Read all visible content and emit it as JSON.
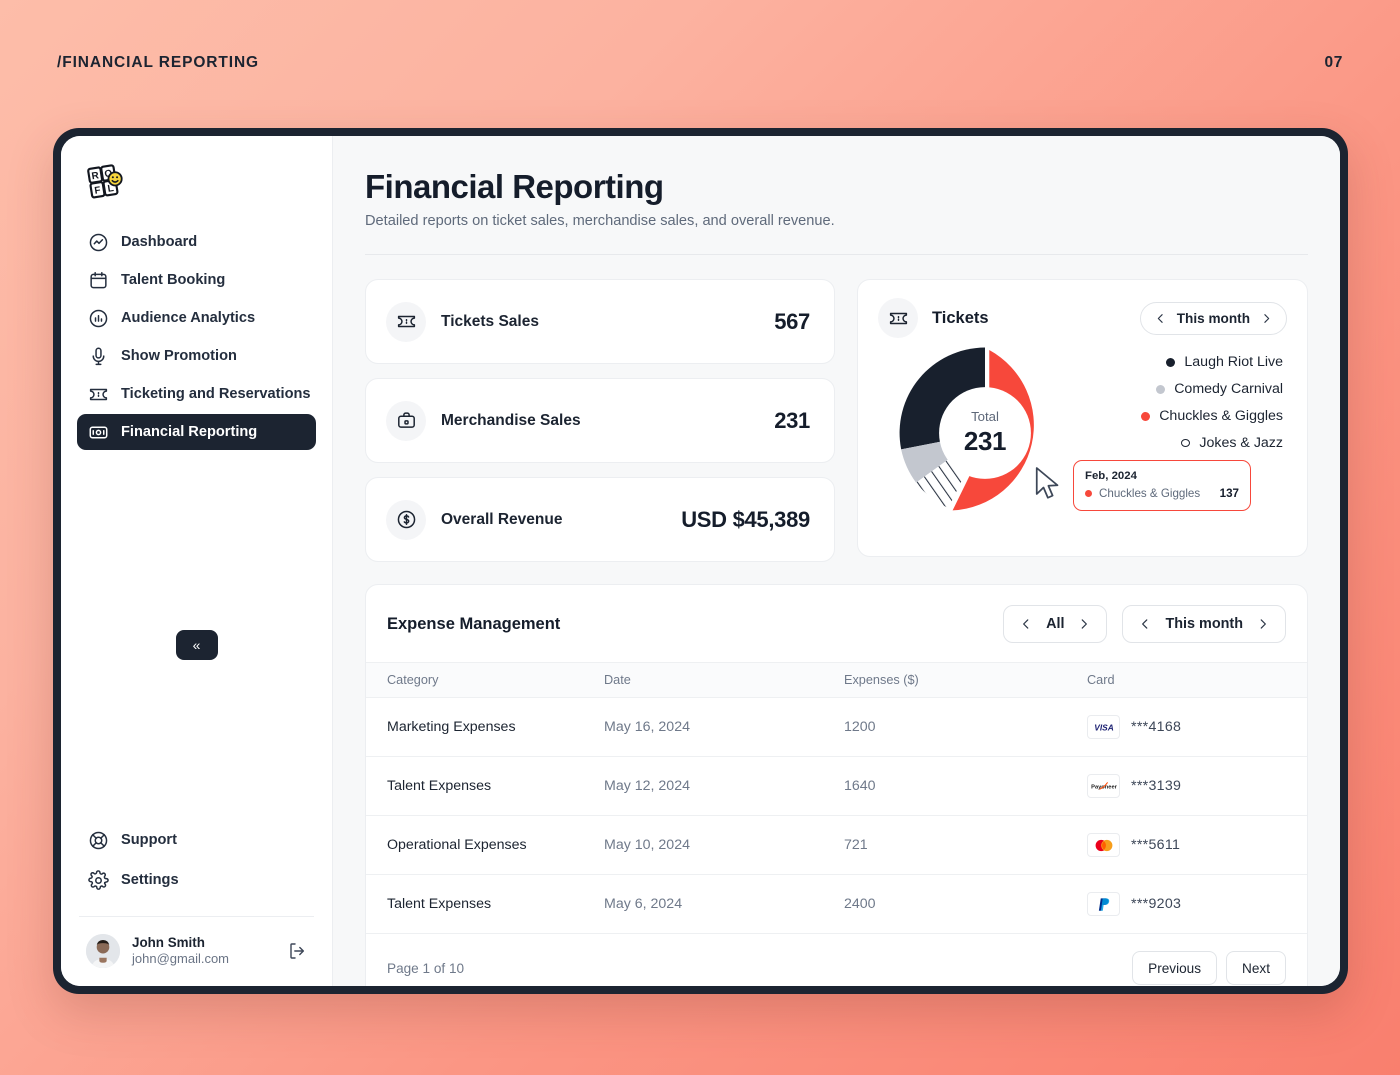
{
  "header": {
    "breadcrumb": "/FINANCIAL REPORTING",
    "page_number": "07"
  },
  "sidebar": {
    "logo_text": "ROFL",
    "items": [
      {
        "label": "Dashboard",
        "icon": "activity-icon",
        "active": false
      },
      {
        "label": "Talent Booking",
        "icon": "calendar-icon",
        "active": false
      },
      {
        "label": "Audience Analytics",
        "icon": "chart-bar-icon",
        "active": false
      },
      {
        "label": "Show Promotion",
        "icon": "microphone-icon",
        "active": false
      },
      {
        "label": "Ticketing and Reservations",
        "icon": "ticket-icon",
        "active": false
      },
      {
        "label": "Financial Reporting",
        "icon": "banknote-icon",
        "active": true
      }
    ],
    "collapse_label": "«",
    "bottom_items": [
      {
        "label": "Support",
        "icon": "lifebuoy-icon"
      },
      {
        "label": "Settings",
        "icon": "gear-icon"
      }
    ],
    "user": {
      "name": "John Smith",
      "email": "john@gmail.com"
    }
  },
  "main": {
    "title": "Financial Reporting",
    "subtitle": "Detailed reports on ticket sales, merchandise sales, and overall revenue.",
    "stats": [
      {
        "label": "Tickets Sales",
        "value": "567",
        "icon": "ticket-icon"
      },
      {
        "label": "Merchandise Sales",
        "value": "231",
        "icon": "briefcase-icon"
      },
      {
        "label": "Overall Revenue",
        "value": "USD $45,389",
        "icon": "dollar-circle-icon"
      }
    ],
    "tickets_panel": {
      "title": "Tickets",
      "icon": "ticket-icon",
      "period_filter": "This month",
      "center_label": "Total",
      "center_value": "231",
      "tooltip": {
        "date": "Feb, 2024",
        "series": "Chuckles & Giggles",
        "value": "137"
      }
    },
    "expense": {
      "title": "Expense Management",
      "filter_all": "All",
      "filter_period": "This month",
      "columns": [
        "Category",
        "Date",
        "Expenses ($)",
        "Card"
      ],
      "rows": [
        {
          "category": "Marketing Expenses",
          "date": "May 16, 2024",
          "expenses": "1200",
          "card_brand": "visa",
          "card_number": "***4168"
        },
        {
          "category": "Talent Expenses",
          "date": "May 12, 2024",
          "expenses": "1640",
          "card_brand": "payoneer",
          "card_number": "***3139"
        },
        {
          "category": "Operational Expenses",
          "date": "May 10, 2024",
          "expenses": "721",
          "card_brand": "mastercard",
          "card_number": "***5611"
        },
        {
          "category": "Talent Expenses",
          "date": "May 6, 2024",
          "expenses": "2400",
          "card_brand": "paypal",
          "card_number": "***9203"
        }
      ],
      "page_label": "Page 1 of 10",
      "previous_label": "Previous",
      "next_label": "Next"
    }
  },
  "chart_data": {
    "type": "pie",
    "title": "Tickets",
    "subtype": "donut",
    "total_label": "Total",
    "total": 231,
    "categories": [
      "Laugh Riot Live",
      "Comedy Carnival",
      "Chuckles & Giggles",
      "Jokes & Jazz"
    ],
    "values": [
      79,
      26,
      108,
      18
    ],
    "colors": [
      "#18202D",
      "#C3C7CF",
      "#F7483B",
      "#FFFFFF"
    ],
    "legend_position": "right",
    "annotation": {
      "date": "Feb, 2024",
      "series": "Chuckles & Giggles",
      "value": 137
    }
  },
  "colors": {
    "accent_red": "#F7483B",
    "dark": "#1C2431",
    "grey": "#C3C7CF",
    "bg_start": "#FDBDA9",
    "bg_end": "#F97F6E"
  }
}
